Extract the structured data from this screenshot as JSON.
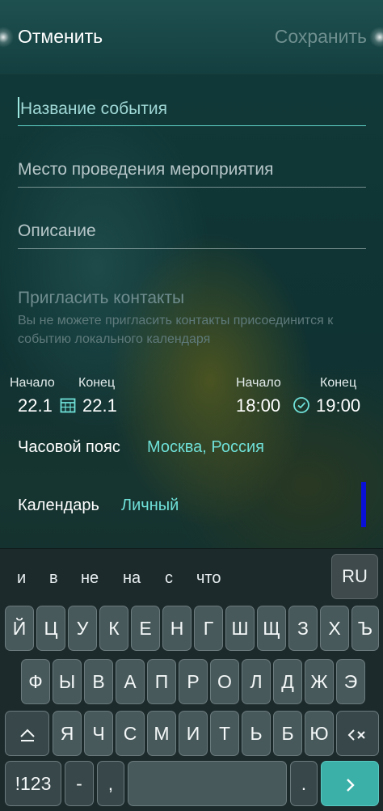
{
  "header": {
    "cancel_label": "Отменить",
    "save_label": "Сохранить"
  },
  "form": {
    "title_placeholder": "Название события",
    "location_placeholder": "Место проведения мероприятия",
    "description_placeholder": "Описание",
    "invite_title": "Пригласить контакты",
    "invite_note": "Вы не можете пригласить контакты присоединится к событию локального календаря"
  },
  "date": {
    "start_label": "Начало",
    "end_label": "Конец",
    "start_value": "22.1",
    "end_value": "22.1"
  },
  "time": {
    "start_label": "Начало",
    "end_label": "Конец",
    "start_value": "18:00",
    "end_value": "19:00"
  },
  "timezone": {
    "label": "Часовой пояс",
    "value": "Москва, Россия"
  },
  "calendar": {
    "label": "Календарь",
    "value": "Личный",
    "color": "#0a10d8"
  },
  "keyboard": {
    "suggestions": [
      "и",
      "в",
      "не",
      "на",
      "с",
      "что"
    ],
    "language_key": "RU",
    "row1": [
      "Й",
      "Ц",
      "У",
      "К",
      "Е",
      "Н",
      "Г",
      "Ш",
      "Щ",
      "З",
      "Х",
      "Ъ"
    ],
    "row2": [
      "Ф",
      "Ы",
      "В",
      "А",
      "П",
      "Р",
      "О",
      "Л",
      "Д",
      "Ж",
      "Э"
    ],
    "row3": [
      "Я",
      "Ч",
      "С",
      "М",
      "И",
      "Т",
      "Ь",
      "Б",
      "Ю"
    ],
    "numbers_key": "!123",
    "dash_key": "-",
    "comma_key": ",",
    "period_key": ".",
    "accent_color": "#3bb0a8"
  }
}
